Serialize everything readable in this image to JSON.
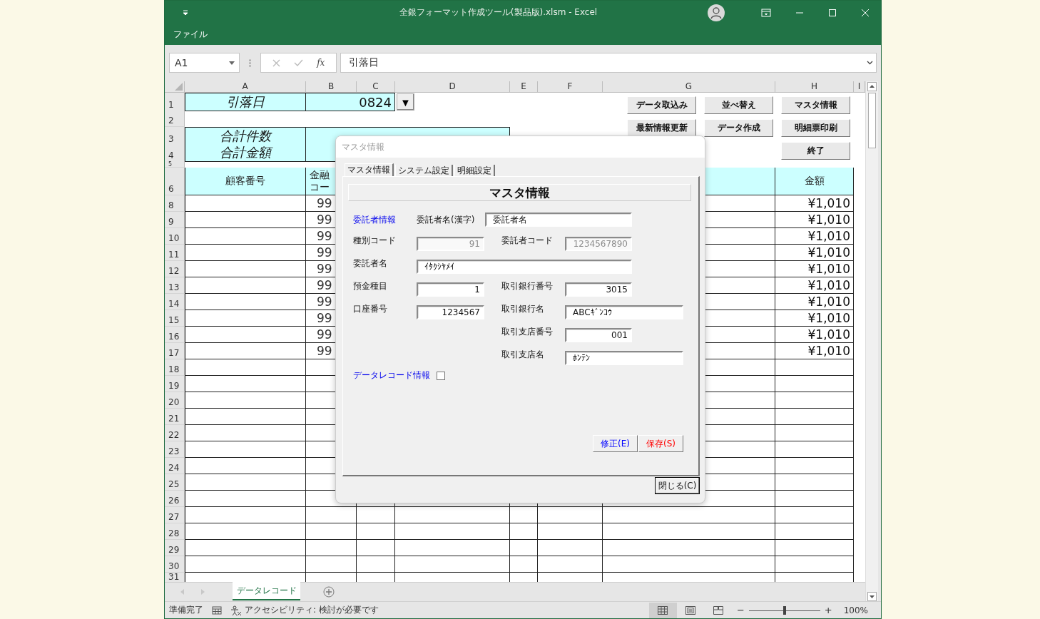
{
  "window": {
    "title": "全銀フォーマット作成ツール(製品版).xlsm  -  Excel",
    "menu": "ファイル"
  },
  "formula_bar": {
    "name_box": "A1",
    "fx": "fx",
    "content": "引落日"
  },
  "sheet": {
    "columns": [
      "A",
      "B",
      "C",
      "D",
      "E",
      "F",
      "G",
      "H",
      "I"
    ],
    "rows": [
      {
        "number": "1",
        "kind": "title",
        "label": "引落日",
        "value": "0824",
        "button": "▼"
      },
      {
        "number": "2",
        "kind": "blank"
      },
      {
        "number": "3",
        "kind": "summary",
        "label": "合計件数"
      },
      {
        "number": "4",
        "kind": "summary",
        "label": "合計金額"
      },
      {
        "number": "5",
        "kind": "spacer"
      },
      {
        "number": "6",
        "kind": "header",
        "customer": "顧客番号",
        "code": "金融コー",
        "amount": "金額"
      },
      {
        "number": "8",
        "kind": "data",
        "code": "99",
        "amount": "¥1,010"
      },
      {
        "number": "9",
        "kind": "data",
        "code": "99",
        "amount": "¥1,010"
      },
      {
        "number": "10",
        "kind": "data",
        "code": "99",
        "amount": "¥1,010"
      },
      {
        "number": "11",
        "kind": "data",
        "code": "99",
        "amount": "¥1,010"
      },
      {
        "number": "12",
        "kind": "data",
        "code": "99",
        "amount": "¥1,010"
      },
      {
        "number": "13",
        "kind": "data",
        "code": "99",
        "amount": "¥1,010"
      },
      {
        "number": "14",
        "kind": "data",
        "code": "99",
        "amount": "¥1,010"
      },
      {
        "number": "15",
        "kind": "data",
        "code": "99",
        "amount": "¥1,010"
      },
      {
        "number": "16",
        "kind": "data",
        "code": "99",
        "amount": "¥1,010"
      },
      {
        "number": "17",
        "kind": "data",
        "code": "99",
        "amount": "¥1,010"
      },
      {
        "number": "18",
        "kind": "data"
      },
      {
        "number": "19",
        "kind": "data"
      },
      {
        "number": "20",
        "kind": "data"
      },
      {
        "number": "21",
        "kind": "data"
      },
      {
        "number": "22",
        "kind": "data"
      },
      {
        "number": "23",
        "kind": "data"
      },
      {
        "number": "24",
        "kind": "data"
      },
      {
        "number": "25",
        "kind": "data"
      },
      {
        "number": "26",
        "kind": "data"
      },
      {
        "number": "27",
        "kind": "data"
      },
      {
        "number": "28",
        "kind": "data"
      },
      {
        "number": "29",
        "kind": "data"
      },
      {
        "number": "30",
        "kind": "data"
      },
      {
        "number": "31",
        "kind": "data"
      }
    ],
    "buttons": [
      {
        "label": "データ取込み"
      },
      {
        "label": "並べ替え"
      },
      {
        "label": "マスタ情報"
      },
      {
        "label": "最新情報更新"
      },
      {
        "label": "データ作成"
      },
      {
        "label": "明細票印刷"
      },
      {
        "label": "終了"
      }
    ]
  },
  "sheet_tabs": [
    {
      "label": "データレコード",
      "selected": true
    }
  ],
  "status_bar": {
    "ready": "準備完了",
    "accessibility": "アクセシビリティ: 検討が必要です",
    "views": [
      {
        "kind": "normal",
        "selected": true
      },
      {
        "kind": "layout",
        "selected": false
      },
      {
        "kind": "pagebreak",
        "selected": false
      }
    ],
    "zoom_minus": "−",
    "zoom_plus": "+",
    "zoom_slider": {
      "level": 0.5
    },
    "zoom": "100%"
  },
  "dialog": {
    "title": "マスタ情報",
    "tabs": [
      {
        "label": "マスタ情報",
        "selected": true
      },
      {
        "label": "システム設定",
        "selected": false
      },
      {
        "label": "明細設定",
        "selected": false
      }
    ],
    "heading": "マスタ情報",
    "section": "委託者情報",
    "fields": [
      {
        "label": "委託者名(漢字)",
        "value": "委託者名",
        "disabled": false
      },
      {
        "label": "種別コード",
        "value": "91",
        "disabled": true
      },
      {
        "label": "委託者コード",
        "value": "1234567890",
        "disabled": true
      },
      {
        "label": "委託者名",
        "value": "ｲﾀｸｼﾔﾒｲ",
        "disabled": false
      },
      {
        "label": "預金種目",
        "value": "1",
        "disabled": false
      },
      {
        "label": "取引銀行番号",
        "value": "3015",
        "disabled": false
      },
      {
        "label": "口座番号",
        "value": "1234567",
        "disabled": false
      },
      {
        "label": "取引銀行名",
        "value": "ABCｷﾞﾝｺｳ",
        "disabled": false
      },
      {
        "label": "取引支店番号",
        "value": "001",
        "disabled": false
      },
      {
        "label": "取引支店名",
        "value": "ﾎﾝﾃﾝ",
        "disabled": false
      }
    ],
    "checkbox": {
      "label": "データレコード情報",
      "checked": false
    },
    "buttons": [
      {
        "label": "修正(E)",
        "color": "#0000ff"
      },
      {
        "label": "保存(S)",
        "color": "#ff0000"
      }
    ],
    "close": "閉じる(C)"
  }
}
